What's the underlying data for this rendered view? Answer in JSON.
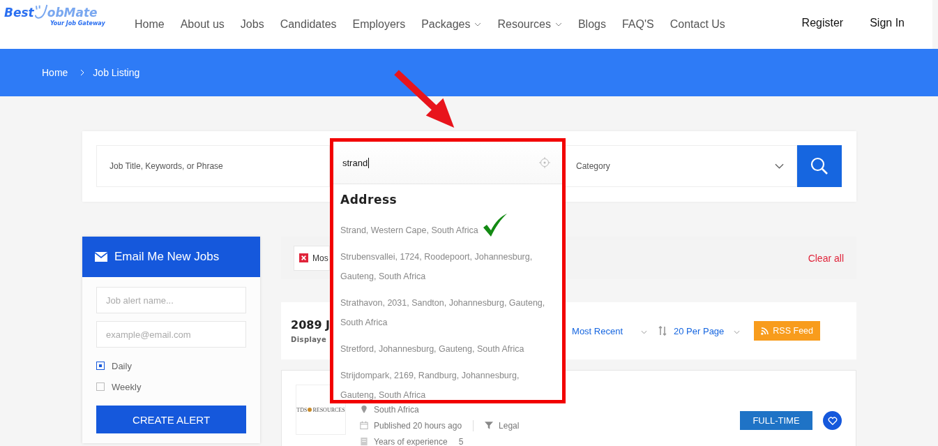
{
  "header": {
    "logo": {
      "word_1": "Best",
      "word_2": "obMate",
      "tagline": "Your Job Gateway"
    },
    "nav": [
      {
        "label": "Home",
        "dropdown": false
      },
      {
        "label": "About us",
        "dropdown": false
      },
      {
        "label": "Jobs",
        "dropdown": false
      },
      {
        "label": "Candidates",
        "dropdown": false
      },
      {
        "label": "Employers",
        "dropdown": false
      },
      {
        "label": "Packages",
        "dropdown": true
      },
      {
        "label": "Resources",
        "dropdown": true
      },
      {
        "label": "Blogs",
        "dropdown": false
      },
      {
        "label": "FAQ'S",
        "dropdown": false
      },
      {
        "label": "Contact Us",
        "dropdown": false
      }
    ],
    "account": [
      "Register",
      "Sign In"
    ]
  },
  "breadcrumb": [
    "Home",
    "Job Listing"
  ],
  "search": {
    "keywords_placeholder": "Job Title, Keywords, or Phrase",
    "location_value": "strand",
    "category_placeholder": "Category"
  },
  "suggestions": {
    "heading": "Address",
    "items": [
      {
        "text": "Strand, Western Cape, South Africa",
        "confirmed": true
      },
      {
        "text": "Strubensvallei, 1724, Roodepoort, Johannesburg, Gauteng, South Africa",
        "confirmed": false
      },
      {
        "text": "Strathavon, 2031, Sandton, Johannesburg, Gauteng, South Africa",
        "confirmed": false
      },
      {
        "text": "Stretford, Johannesburg, Gauteng, South Africa",
        "confirmed": false
      },
      {
        "text": "Strijdompark, 2169, Randburg, Johannesburg, Gauteng, South Africa",
        "confirmed": false
      }
    ]
  },
  "alert_form": {
    "title": "Email Me New Jobs",
    "name_placeholder": "Job alert name...",
    "email_placeholder": "example@email.com",
    "frequencies": [
      {
        "label": "Daily",
        "selected": true
      },
      {
        "label": "Weekly",
        "selected": false
      }
    ],
    "button": "CREATE ALERT"
  },
  "filters": {
    "chips": [
      "Mos"
    ],
    "clear": "Clear all"
  },
  "results": {
    "count": "2089 J",
    "subtitle": "Displaye",
    "sort": "Most Recent",
    "per_page": "20 Per Page",
    "rss": "RSS Feed"
  },
  "job": {
    "logo_left": "TDS",
    "logo_right": "RESOURCES",
    "location": "South Africa",
    "published": "Published 20 hours ago",
    "category": "Legal",
    "experience_label": "Years of experience",
    "experience_value": "5",
    "type": "FULL-TIME",
    "saved": false
  }
}
